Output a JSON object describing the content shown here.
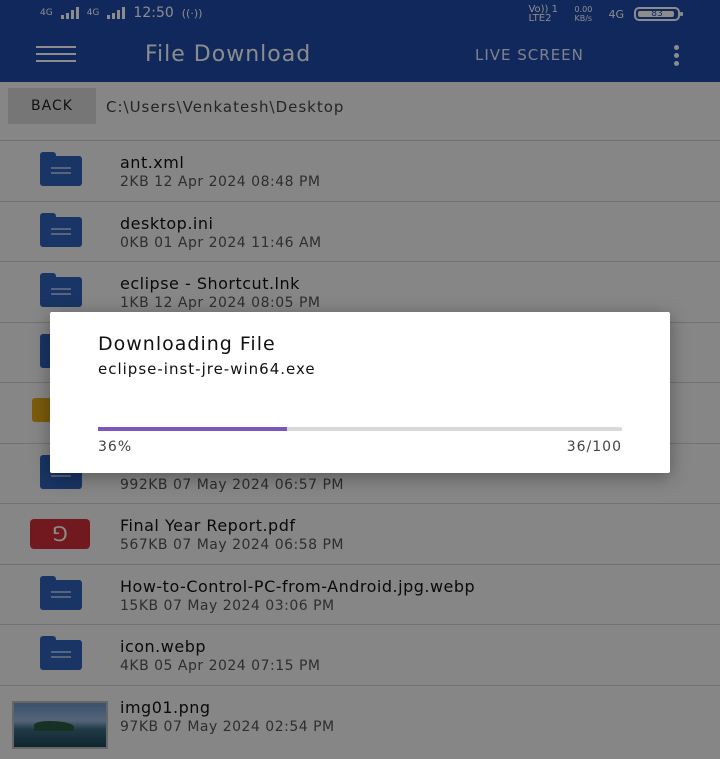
{
  "status_bar": {
    "network_1": "4G",
    "network_2": "4G",
    "time": "12:50",
    "volte": "Vo)) 1 LTE2",
    "speed": "0.00 KB/s",
    "network_3": "4G",
    "battery": "83"
  },
  "app_bar": {
    "title": "File Download",
    "live_screen_label": "LIVE SCREEN"
  },
  "path_bar": {
    "back_label": "BACK",
    "path": "C:\\Users\\Venkatesh\\Desktop"
  },
  "files": [
    {
      "name": "ant.xml",
      "meta": "2KB 12 Apr 2024 08:48 PM",
      "icon": "doc-icon"
    },
    {
      "name": "desktop.ini",
      "meta": "0KB 01 Apr 2024 11:46 AM",
      "icon": "doc-icon"
    },
    {
      "name": "eclipse - Shortcut.lnk",
      "meta": "1KB 12 Apr 2024 08:05 PM",
      "icon": "doc-icon"
    },
    {
      "name": "",
      "meta": "",
      "icon": "doc-icon"
    },
    {
      "name": "",
      "meta": "",
      "icon": "folder-icon"
    },
    {
      "name": "",
      "meta": "992KB 07 May 2024 06:57 PM",
      "icon": "doc-icon"
    },
    {
      "name": "Final Year Report.pdf",
      "meta": "567KB 07 May 2024 06:58 PM",
      "icon": "pdf-icon"
    },
    {
      "name": "How-to-Control-PC-from-Android.jpg.webp",
      "meta": "15KB 07 May 2024 03:06 PM",
      "icon": "doc-icon"
    },
    {
      "name": "icon.webp",
      "meta": "4KB 05 Apr 2024 07:15 PM",
      "icon": "doc-icon"
    },
    {
      "name": "img01.png",
      "meta": "97KB 07 May 2024 02:54 PM",
      "icon": "image-thumbnail"
    }
  ],
  "dialog": {
    "title": "Downloading File",
    "filename": "eclipse-inst-jre-win64.exe",
    "progress_percent": 36,
    "percent_label": "36%",
    "count_label": "36/100",
    "accent_color": "#7e55b8"
  },
  "colors": {
    "primary": "#1e4aa8",
    "pdf": "#cf2e3b",
    "folder": "#e0a817"
  }
}
